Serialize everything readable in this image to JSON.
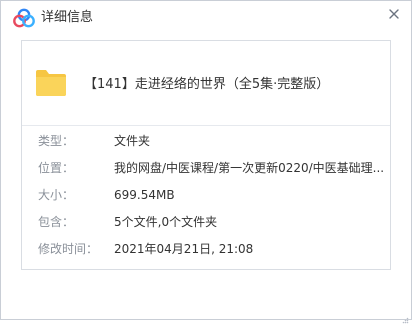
{
  "dialog": {
    "title": "详细信息",
    "logo_icon": "baidu-netdisk-logo-icon",
    "close_icon": "close-icon",
    "accent_color": "#2f86f6",
    "folder_color": "#f6c643"
  },
  "file": {
    "name": "【141】走进经络的世界（全5集·完整版）",
    "icon": "folder-icon"
  },
  "details": [
    {
      "label": "类型：",
      "value": "文件夹"
    },
    {
      "label": "位置：",
      "value": "我的网盘/中医课程/第一次更新0220/中医基础理..."
    },
    {
      "label": "大小：",
      "value": "699.54MB"
    },
    {
      "label": "包含：",
      "value": "5个文件,0个文件夹"
    },
    {
      "label": "修改时间：",
      "value": "2021年04月21日, 21:08"
    }
  ]
}
